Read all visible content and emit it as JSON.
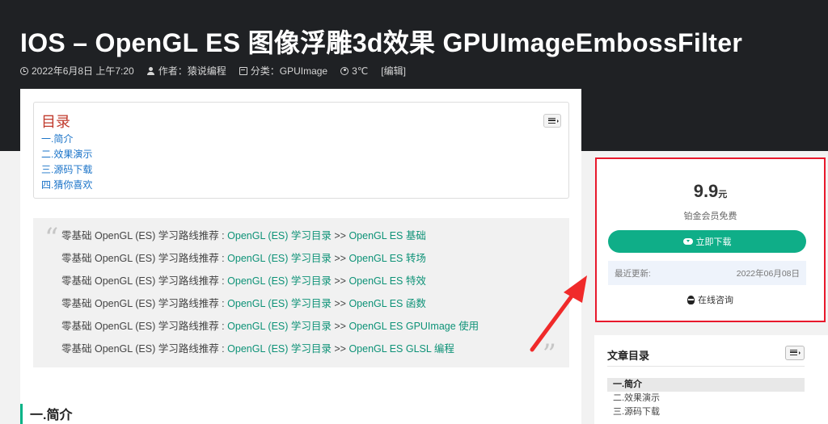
{
  "header": {
    "title": "IOS – OpenGL ES 图像浮雕3d效果 GPUImageEmbossFilter",
    "meta": {
      "date": "2022年6月8日 上午7:20",
      "author": "作者：猿说编程",
      "category": "分类：GPUImage",
      "views": "3℃",
      "edit": "[编辑]"
    }
  },
  "toc": {
    "title": "目录",
    "items": [
      "一.简介",
      "二.效果演示",
      "三.源码下载",
      "四.猜你喜欢"
    ]
  },
  "quote": {
    "open_mark": "“",
    "close_mark": "”",
    "lines": [
      {
        "prefix": "零基础 OpenGL (ES) 学习路线推荐 : ",
        "link1": "OpenGL (ES) 学习目录",
        "sep": " >> ",
        "link2": "OpenGL ES 基础"
      },
      {
        "prefix": "零基础 OpenGL (ES) 学习路线推荐 : ",
        "link1": "OpenGL (ES) 学习目录",
        "sep": " >> ",
        "link2": "OpenGL ES 转场"
      },
      {
        "prefix": "零基础 OpenGL (ES) 学习路线推荐 : ",
        "link1": "OpenGL (ES) 学习目录",
        "sep": " >> ",
        "link2": "OpenGL ES 特效"
      },
      {
        "prefix": "零基础 OpenGL (ES) 学习路线推荐 : ",
        "link1": "OpenGL (ES) 学习目录",
        "sep": " >> ",
        "link2": "OpenGL ES 函数"
      },
      {
        "prefix": "零基础 OpenGL (ES) 学习路线推荐 : ",
        "link1": "OpenGL (ES) 学习目录",
        "sep": " >> ",
        "link2": "OpenGL ES GPUImage 使用"
      },
      {
        "prefix": "零基础 OpenGL (ES) 学习路线推荐 : ",
        "link1": "OpenGL (ES) 学习目录",
        "sep": " >> ",
        "link2": "OpenGL ES GLSL 编程"
      }
    ]
  },
  "section": {
    "heading": "一.简介"
  },
  "download_panel": {
    "price": "9.9",
    "unit": "元",
    "member_note": "铂金会员免费",
    "download_label": "立即下载",
    "updated_label": "最近更新:",
    "updated_value": "2022年06月08日",
    "consult_label": "在线咨询"
  },
  "sidebar_toc": {
    "title": "文章目录",
    "items": [
      {
        "label": "一.简介",
        "active": true
      },
      {
        "label": "二.效果演示",
        "active": false
      },
      {
        "label": "三.源码下载",
        "active": false
      }
    ]
  },
  "colors": {
    "accent_green": "#0fae88",
    "highlight_red": "#e8192c",
    "toc_title_red": "#c0392b",
    "link_blue": "#1a73c8"
  }
}
